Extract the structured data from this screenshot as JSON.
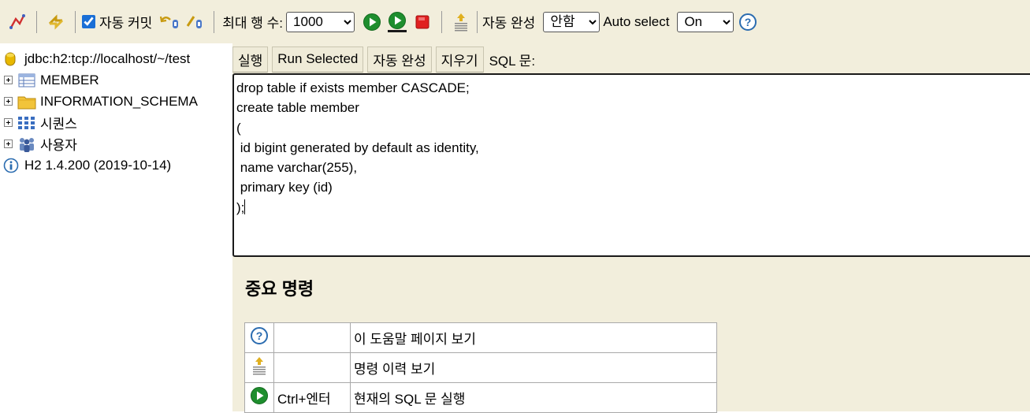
{
  "toolbar": {
    "autocommit_label": "자동 커밋",
    "autocommit_checked": true,
    "max_rows_label": "최대 행 수:",
    "max_rows_value": "1000",
    "autocomplete_label": "자동 완성",
    "autocomplete_value": "안함",
    "autoselect_label": "Auto select",
    "autoselect_value": "On"
  },
  "tree": {
    "connection": "jdbc:h2:tcp://localhost/~/test",
    "items": [
      {
        "label": "MEMBER",
        "icon": "table-icon"
      },
      {
        "label": "INFORMATION_SCHEMA",
        "icon": "folder-icon"
      },
      {
        "label": "시퀀스",
        "icon": "sequence-icon"
      },
      {
        "label": "사용자",
        "icon": "users-icon"
      }
    ],
    "version": "H2 1.4.200 (2019-10-14)"
  },
  "buttons": {
    "run": "실행",
    "run_selected": "Run Selected",
    "autocomplete": "자동 완성",
    "clear": "지우기",
    "sql_label": "SQL 문:"
  },
  "editor": {
    "lines": [
      "drop table if exists member CASCADE;",
      "create table member",
      "(",
      " id bigint generated by default as identity,",
      " name varchar(255),",
      " primary key (id)",
      ");"
    ]
  },
  "help": {
    "title": "중요 명령",
    "rows": [
      {
        "icon": "help-icon",
        "key": "",
        "desc": "이 도움말 페이지 보기"
      },
      {
        "icon": "history-icon",
        "key": "",
        "desc": "명령 이력 보기"
      },
      {
        "icon": "run-icon",
        "key": "Ctrl+엔터",
        "desc": "현재의 SQL 문 실행"
      }
    ]
  },
  "colors": {
    "panel_background": "#f2eedc",
    "run_green": "#1e8e2e",
    "stop_red": "#e02020",
    "help_blue": "#2b6cb0"
  }
}
